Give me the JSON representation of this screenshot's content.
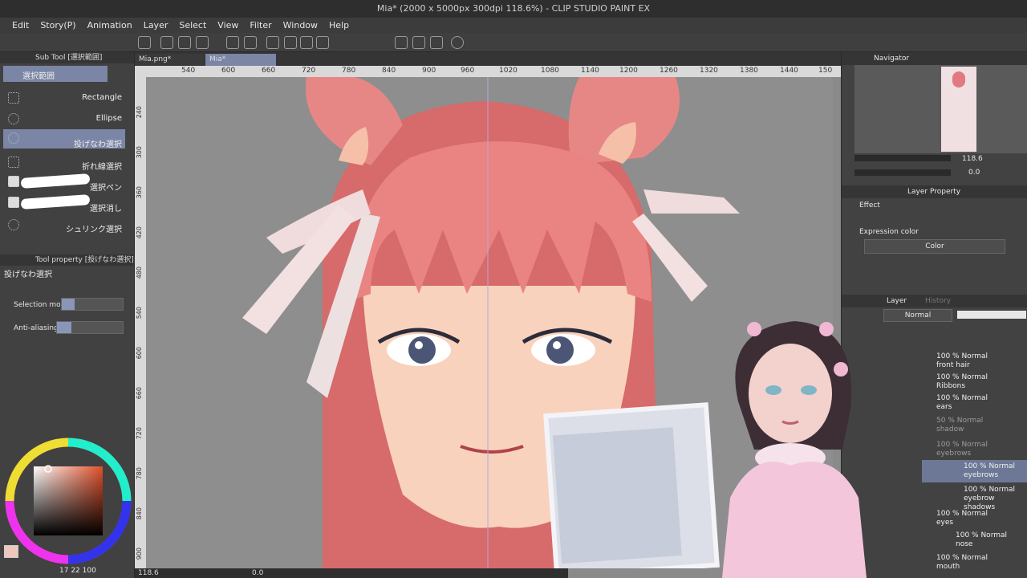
{
  "window": {
    "title": "Mia* (2000 x 5000px 300dpi 118.6%) - CLIP STUDIO PAINT EX"
  },
  "menu": [
    "Edit",
    "Story(P)",
    "Animation",
    "Layer",
    "Select",
    "View",
    "Filter",
    "Window",
    "Help"
  ],
  "subtool": {
    "header": "Sub Tool [選択範囲]",
    "group": "選択範囲",
    "items": [
      "Rectangle",
      "Ellipse",
      "投げなわ選択",
      "折れ線選択",
      "選択ペン",
      "選択消し",
      "シュリンク選択"
    ],
    "selected_index": 2
  },
  "toolprop": {
    "header": "Tool property [投げなわ選択]",
    "name": "投げなわ選択",
    "selection_mode_label": "Selection mode",
    "anti_aliasing_label": "Anti-aliasing"
  },
  "color": {
    "main": "#f0c7bb",
    "values": "17 22 100"
  },
  "tabs": [
    "Mia.png*",
    "Mia*"
  ],
  "ruler_h": [
    "540",
    "600",
    "660",
    "720",
    "780",
    "840",
    "900",
    "960",
    "1020",
    "1080",
    "1140",
    "1200",
    "1260",
    "1320",
    "1380",
    "1440",
    "150"
  ],
  "ruler_v": [
    "240",
    "300",
    "360",
    "420",
    "480",
    "540",
    "600",
    "660",
    "720",
    "780",
    "840",
    "900"
  ],
  "navigator": {
    "title": "Navigator",
    "zoom": "118.6",
    "angle": "0.0"
  },
  "layer_property": {
    "title": "Layer Property",
    "effect_label": "Effect",
    "expression_label": "Expression color",
    "expression_value": "Color"
  },
  "layer_panel": {
    "tabs": [
      "Layer",
      "History"
    ],
    "blend_mode": "Normal",
    "layers": [
      {
        "mode": "100 % Normal",
        "name": "front hair"
      },
      {
        "mode": "100 % Normal",
        "name": "Ribbons"
      },
      {
        "mode": "100 % Normal",
        "name": "ears"
      },
      {
        "mode": "50 % Normal",
        "name": "shadow"
      },
      {
        "mode": "100 % Normal",
        "name": "eyebrows"
      },
      {
        "mode": "100 % Normal",
        "name": "eyebrows"
      },
      {
        "mode": "100 % Normal",
        "name": "eyebrow shadows"
      },
      {
        "mode": "100 % Normal",
        "name": "eyes"
      },
      {
        "mode": "100 % Normal",
        "name": "nose"
      },
      {
        "mode": "100 % Normal",
        "name": "mouth"
      }
    ]
  },
  "status": {
    "zoom": "118.6",
    "angle": "0.0"
  }
}
